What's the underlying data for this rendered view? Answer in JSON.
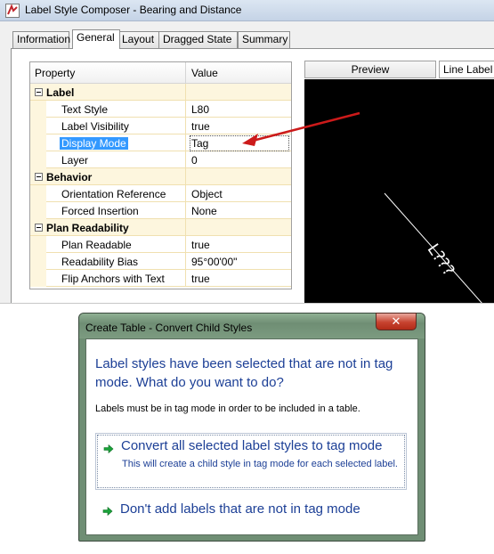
{
  "composer": {
    "title": "Label Style Composer - Bearing and Distance",
    "tabs": [
      "Information",
      "General",
      "Layout",
      "Dragged State",
      "Summary"
    ],
    "active_tab": "General",
    "grid_headers": {
      "property": "Property",
      "value": "Value"
    },
    "rows": [
      {
        "type": "category",
        "name": "Label"
      },
      {
        "type": "property",
        "name": "Text Style",
        "value": "L80"
      },
      {
        "type": "property",
        "name": "Label Visibility",
        "value": "true"
      },
      {
        "type": "property",
        "name": "Display Mode",
        "value": "Tag",
        "selected": true
      },
      {
        "type": "property",
        "name": "Layer",
        "value": "0"
      },
      {
        "type": "category",
        "name": "Behavior"
      },
      {
        "type": "property",
        "name": "Orientation Reference",
        "value": "Object"
      },
      {
        "type": "property",
        "name": "Forced Insertion",
        "value": "None"
      },
      {
        "type": "category",
        "name": "Plan Readability"
      },
      {
        "type": "property",
        "name": "Plan Readable",
        "value": "true"
      },
      {
        "type": "property",
        "name": "Readability Bias",
        "value": "95°00'00\""
      },
      {
        "type": "property",
        "name": "Flip Anchors with Text",
        "value": "true"
      }
    ],
    "preview": {
      "tab_label": "Preview",
      "style_tab_label": "Line Label St",
      "sample_text": "L???"
    },
    "annotation_color": "#cc1a1a"
  },
  "dialog": {
    "title": "Create Table - Convert Child Styles",
    "close_glyph": "✕",
    "heading": "Label styles have been selected that are not in tag mode.   What do you want to do?",
    "info": "Labels must be in tag mode in order to be included in a table.",
    "commands": [
      {
        "label": "Convert all selected label styles to tag mode",
        "note": "This will create a child style in tag mode for each selected label."
      },
      {
        "label": "Don't add labels that are not in tag mode"
      }
    ],
    "link_color": "#1c3f96",
    "arrow_color": "#1aa33a"
  }
}
